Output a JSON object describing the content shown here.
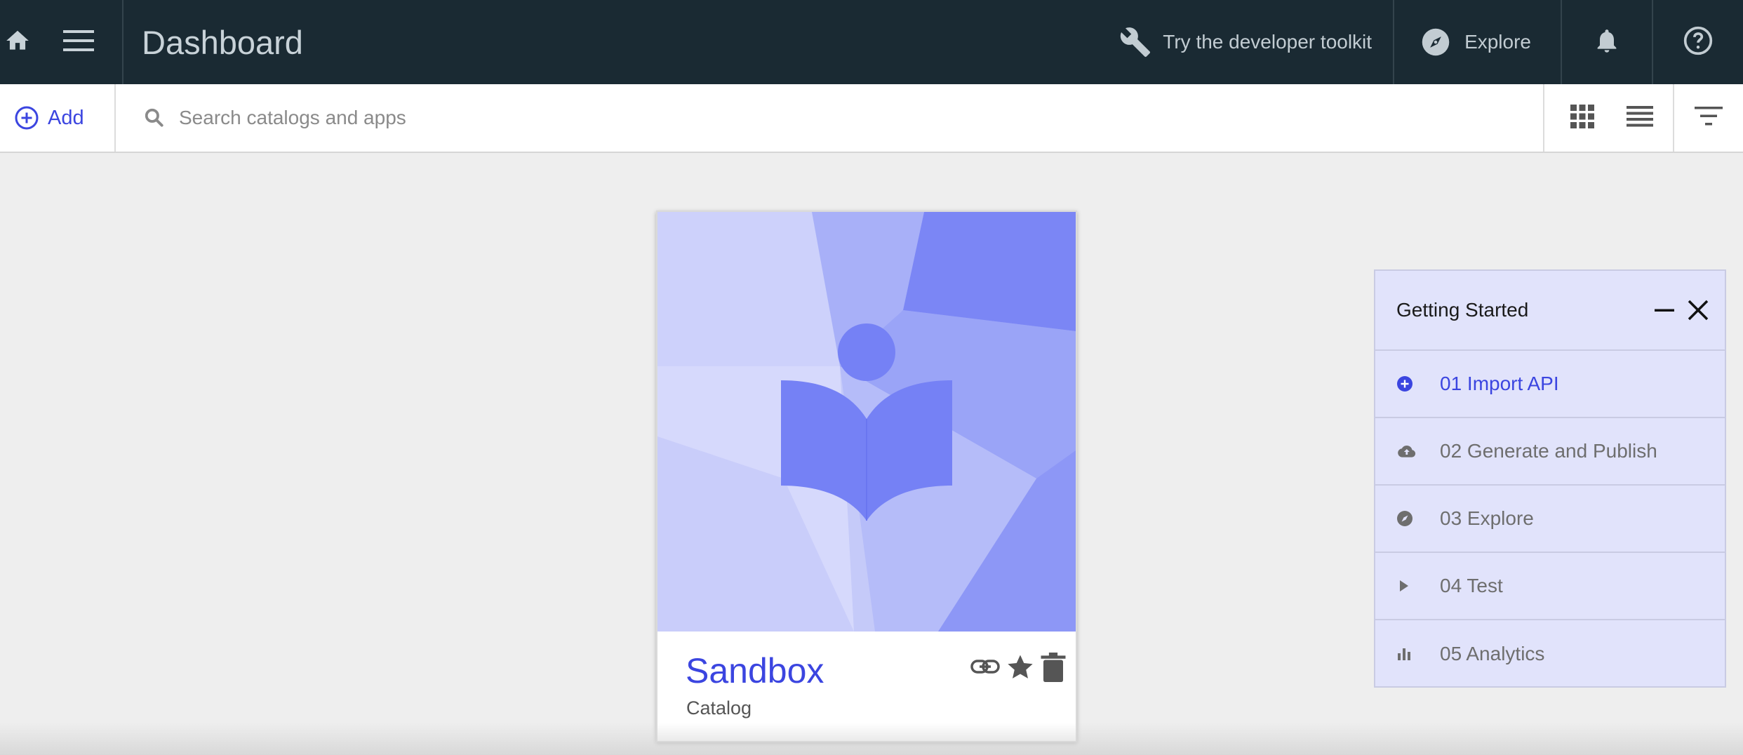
{
  "topbar": {
    "title": "Dashboard",
    "toolkit_label": "Try the developer toolkit",
    "explore_label": "Explore"
  },
  "toolbar": {
    "add_label": "Add",
    "search_placeholder": "Search catalogs and apps"
  },
  "card": {
    "name": "Sandbox",
    "type": "Catalog"
  },
  "getting_started": {
    "title": "Getting Started",
    "items": [
      {
        "label": "01 Import API",
        "icon": "add-circle-icon",
        "active": true
      },
      {
        "label": "02 Generate and Publish",
        "icon": "cloud-upload-icon"
      },
      {
        "label": "03 Explore",
        "icon": "compass-icon"
      },
      {
        "label": "04 Test",
        "icon": "play-icon"
      },
      {
        "label": "05 Analytics",
        "icon": "bar-chart-icon"
      }
    ]
  },
  "colors": {
    "topbar_bg": "#1a2a33",
    "accent": "#3b45e0",
    "panel_bg": "#e1e3fb",
    "page_bg": "#eeeeee"
  }
}
